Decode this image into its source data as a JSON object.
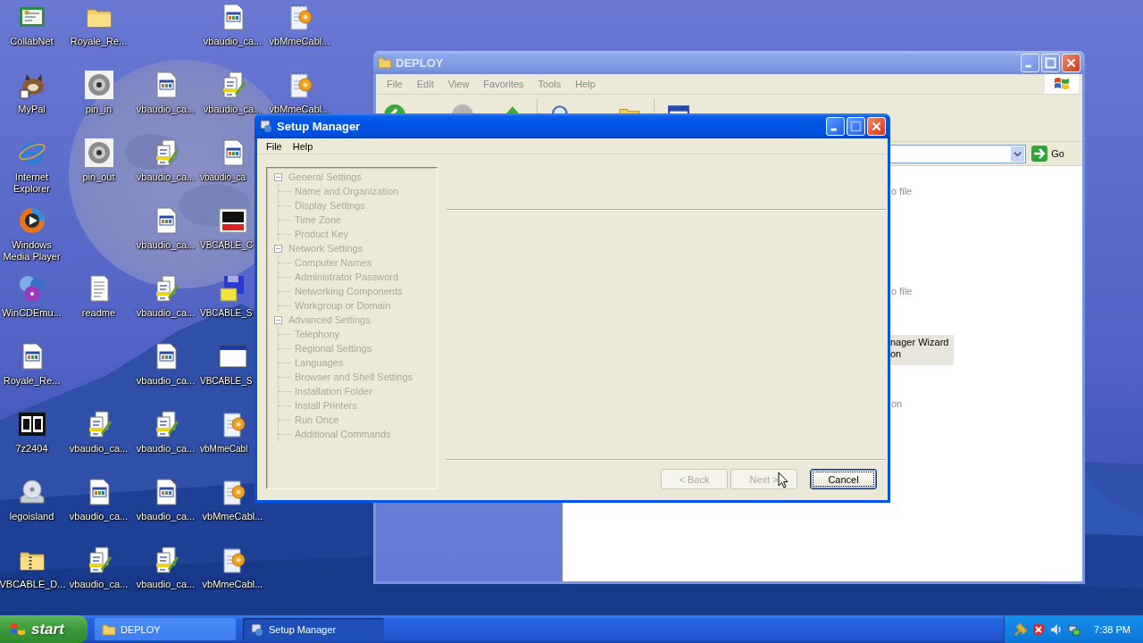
{
  "desktop_icons": [
    [
      {
        "label": "CollabNet",
        "kind": "certificate"
      },
      {
        "label": "MyPal",
        "kind": "animal"
      },
      {
        "label": "Internet Explorer",
        "kind": "browser"
      },
      {
        "label": "Windows Media Player",
        "kind": "media"
      },
      {
        "label": "WinCDEmu...",
        "kind": "discs"
      },
      {
        "label": "Royale_Re...",
        "kind": "webdoc"
      },
      {
        "label": "7z2404",
        "kind": "archive"
      },
      {
        "label": "legoisland",
        "kind": "cdinstall"
      },
      {
        "label": "VBCABLE_D...",
        "kind": "zipfolder"
      }
    ],
    [
      {
        "label": "Royale_Re...",
        "kind": "folder"
      },
      {
        "label": "pin_in",
        "kind": "disc"
      },
      {
        "label": "pin_out",
        "kind": "disc"
      },
      {
        "label": "readme",
        "kind": "textdoc"
      },
      {
        "label": "vbaudio_ca...",
        "kind": "batch"
      },
      {
        "label": "vbaudio_ca...",
        "kind": "webdoc"
      },
      {
        "label": "vbaudio_ca...",
        "kind": "batch"
      }
    ],
    [
      {
        "label": "vbaudio_ca...",
        "kind": "webdoc"
      },
      {
        "label": "vbaudio_ca...",
        "kind": "batch"
      },
      {
        "label": "vbaudio_ca...",
        "kind": "webdoc"
      },
      {
        "label": "vbaudio_ca...",
        "kind": "batch"
      },
      {
        "label": "vbaudio_ca...",
        "kind": "webdoc"
      },
      {
        "label": "vbaudio_ca...",
        "kind": "batch"
      },
      {
        "label": "vbaudio_ca...",
        "kind": "webdoc"
      },
      {
        "label": "vbaudio_ca...",
        "kind": "batch"
      }
    ],
    [
      {
        "label": "vbaudio_ca...",
        "kind": "webdoc"
      },
      {
        "label": "vbaudio_ca...",
        "kind": "batch"
      },
      {
        "label": "vbaudio_ca",
        "kind": "webdoc"
      },
      {
        "label": "VBCABLE_C",
        "kind": "logo"
      },
      {
        "label": "VBCABLE_S",
        "kind": "floppy"
      },
      {
        "label": "VBCABLE_S",
        "kind": "appwindow"
      },
      {
        "label": "vbMmeCabl",
        "kind": "config"
      },
      {
        "label": "vbMmeCabl...",
        "kind": "config"
      },
      {
        "label": "vbMmeCabl...",
        "kind": "config"
      }
    ],
    [
      {
        "label": "vbMmeCabl...",
        "kind": "config"
      },
      {
        "label": "vbMmeCabl...",
        "kind": "config"
      }
    ]
  ],
  "explorer_window": {
    "title": "DEPLOY",
    "menu": [
      "File",
      "Edit",
      "View",
      "Favorites",
      "Tools",
      "Help"
    ],
    "go": "Go",
    "file_fragments": [
      {
        "text": "o file",
        "selected": false
      },
      {
        "text": "o file",
        "selected": false
      },
      {
        "text": "nager Wizard\non",
        "selected": true
      },
      {
        "text": "on",
        "selected": false
      }
    ]
  },
  "setup_window": {
    "title": "Setup Manager",
    "menu": [
      "File",
      "Help"
    ],
    "tree": [
      {
        "label": "General Settings",
        "expanded": true,
        "disabled": true,
        "children": [
          {
            "label": "Name and Organization",
            "disabled": true
          },
          {
            "label": "Display Settings",
            "disabled": true
          },
          {
            "label": "Time Zone",
            "disabled": true
          },
          {
            "label": "Product Key",
            "disabled": true
          }
        ]
      },
      {
        "label": "Network Settings",
        "expanded": true,
        "disabled": true,
        "children": [
          {
            "label": "Computer Names",
            "disabled": true
          },
          {
            "label": "Administrator Password",
            "disabled": true
          },
          {
            "label": "Networking Components",
            "disabled": true
          },
          {
            "label": "Workgroup or Domain",
            "disabled": true
          }
        ]
      },
      {
        "label": "Advanced Settings",
        "expanded": true,
        "disabled": true,
        "children": [
          {
            "label": "Telephony",
            "disabled": true
          },
          {
            "label": "Regional Settings",
            "disabled": true
          },
          {
            "label": "Languages",
            "disabled": true
          },
          {
            "label": "Browser and Shell Settings",
            "disabled": true
          },
          {
            "label": "Installation Folder",
            "disabled": true
          },
          {
            "label": "Install Printers",
            "disabled": true
          },
          {
            "label": "Run Once",
            "disabled": true
          },
          {
            "label": "Additional Commands",
            "disabled": true
          }
        ]
      }
    ],
    "buttons": [
      {
        "label": "< Back",
        "disabled": true,
        "focused": false
      },
      {
        "label": "Next >",
        "disabled": true,
        "focused": false
      },
      {
        "label": "Cancel",
        "disabled": false,
        "focused": true
      }
    ]
  },
  "taskbar": {
    "start": "start",
    "tasks": [
      {
        "label": "DEPLOY",
        "kind": "folder",
        "selected": false
      },
      {
        "label": "Setup Manager",
        "kind": "setup",
        "selected": true
      }
    ],
    "clock": "7:38 PM"
  }
}
